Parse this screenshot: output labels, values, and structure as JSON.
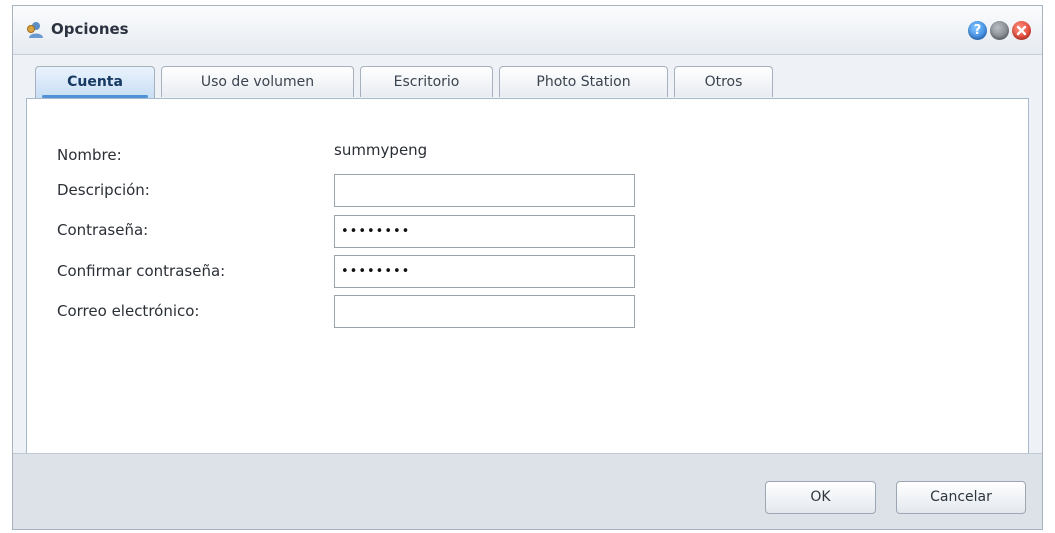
{
  "window": {
    "title": "Opciones"
  },
  "tabs": [
    {
      "label": "Cuenta",
      "active": true
    },
    {
      "label": "Uso de volumen",
      "active": false
    },
    {
      "label": "Escritorio",
      "active": false
    },
    {
      "label": "Photo Station",
      "active": false
    },
    {
      "label": "Otros",
      "active": false
    }
  ],
  "form": {
    "name_label": "Nombre:",
    "name_value": "summypeng",
    "description_label": "Descripción:",
    "description_value": "",
    "password_label": "Contraseña:",
    "password_value": "••••••••",
    "confirm_label": "Confirmar contraseña:",
    "confirm_value": "••••••••",
    "email_label": "Correo electrónico:",
    "email_value": ""
  },
  "buttons": {
    "ok": "OK",
    "cancel": "Cancelar"
  },
  "window_buttons": {
    "help": "?"
  },
  "colors": {
    "accent": "#4f92d6",
    "close": "#d52a1a",
    "help": "#1f6fd1"
  }
}
